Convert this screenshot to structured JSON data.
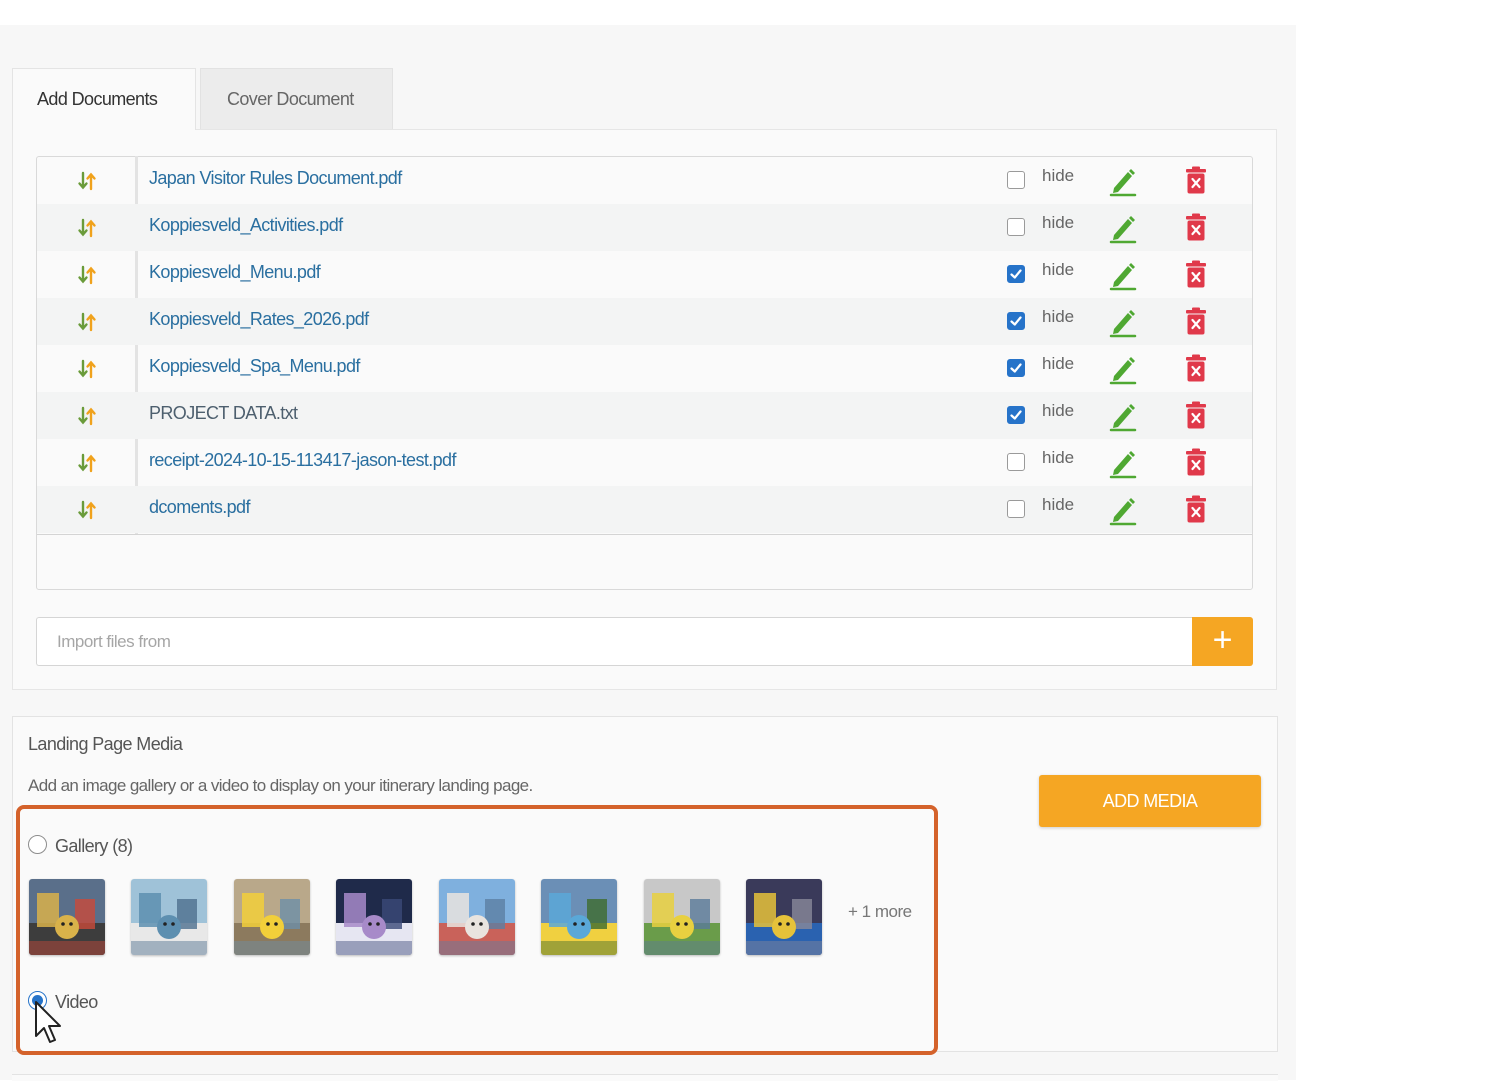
{
  "tabs": [
    {
      "label": "Add Documents",
      "active": true
    },
    {
      "label": "Cover Document",
      "active": false
    }
  ],
  "documents": [
    {
      "name": "Japan Visitor Rules Document.pdf",
      "hidden": false,
      "hide_label": "hide"
    },
    {
      "name": "Koppiesveld_Activities.pdf",
      "hidden": false,
      "hide_label": "hide"
    },
    {
      "name": "Koppiesveld_Menu.pdf",
      "hidden": true,
      "hide_label": "hide"
    },
    {
      "name": "Koppiesveld_Rates_2026.pdf",
      "hidden": true,
      "hide_label": "hide"
    },
    {
      "name": "Koppiesveld_Spa_Menu.pdf",
      "hidden": true,
      "hide_label": "hide"
    },
    {
      "name": "PROJECT DATA.txt",
      "hidden": true,
      "hide_label": "hide"
    },
    {
      "name": "receipt-2024-10-15-113417-jason-test.pdf",
      "hidden": false,
      "hide_label": "hide"
    },
    {
      "name": "dcoments.pdf",
      "hidden": false,
      "hide_label": "hide"
    }
  ],
  "import": {
    "placeholder": "Import files from",
    "add_icon": "plus-icon"
  },
  "media": {
    "title": "Landing Page Media",
    "description": "Add an image gallery or a video to display on your itinerary landing page.",
    "add_button": "ADD MEDIA",
    "gallery_label": "Gallery (8)",
    "gallery_selected": false,
    "video_label": "Video",
    "video_selected": true,
    "more_label": "+ 1 more",
    "thumbnails": [
      "pikachu-gate-photo",
      "pokemon-statue-photo",
      "pikachu-street-photo",
      "city-night-photo",
      "tower-building-photo",
      "pokemon-float-photo",
      "pikachu-stage-photo",
      "pikachu-museum-photo"
    ]
  },
  "colors": {
    "accent": "#f5a623",
    "link": "#2a6fa0",
    "checkbox": "#2673c9",
    "edit_icon": "#4fa832",
    "delete_icon": "#e0394a",
    "highlight_border": "#d4622b"
  }
}
